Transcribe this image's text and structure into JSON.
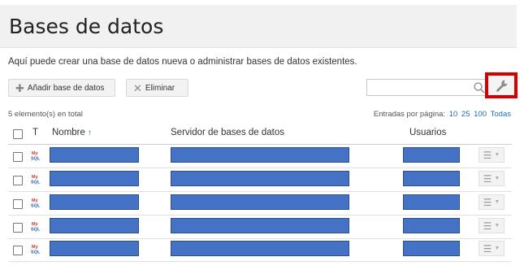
{
  "page": {
    "title": "Bases de datos",
    "description": "Aquí puede crear una base de datos nueva o administrar bases de datos existentes."
  },
  "toolbar": {
    "add_label": "Añadir base de datos",
    "delete_label": "Eliminar",
    "search_placeholder": "",
    "search_value": ""
  },
  "list_info": {
    "total": "5 elemento(s) en total",
    "per_page_label": "Entradas por página:",
    "per_page_options": [
      "10",
      "25",
      "100",
      "Todas"
    ]
  },
  "table": {
    "columns": {
      "type": "T",
      "name": "Nombre",
      "server": "Servidor de bases de datos",
      "users": "Usuarios"
    },
    "rows": [
      {
        "type_icon": "mysql-icon"
      },
      {
        "type_icon": "mysql-icon"
      },
      {
        "type_icon": "mysql-icon"
      },
      {
        "type_icon": "mysql-icon"
      },
      {
        "type_icon": "mysql-icon"
      }
    ]
  },
  "colors": {
    "redacted": "#4472c4",
    "link": "#1f6fb2",
    "highlight_box": "#d40000"
  }
}
